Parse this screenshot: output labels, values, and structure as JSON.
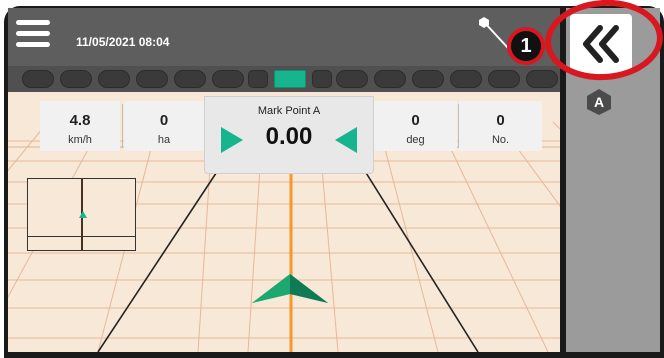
{
  "header": {
    "datetime": "11/05/2021 08:04"
  },
  "info_bar": {
    "speed": {
      "value": "4.8",
      "unit": "km/h"
    },
    "area": {
      "value": "0",
      "unit": "ha"
    },
    "heading": {
      "value": "0",
      "unit": "deg"
    },
    "count": {
      "value": "0",
      "unit": "No."
    }
  },
  "guidance": {
    "mark_label": "Mark Point A",
    "cross_track": "0.00"
  },
  "sections": {
    "total": 14,
    "active_index": 7
  },
  "sidebar": {
    "collapse_icon": "double-chevron-left-icon",
    "ab_badge": "A"
  },
  "callout": {
    "number": "1"
  },
  "colors": {
    "accent": "#16b58d",
    "guideline": "#f29a2e",
    "field": "#f7e8d8",
    "callout": "#d8181e",
    "topbar": "#5e5e5e",
    "sidebar": "#9b9b9b"
  }
}
